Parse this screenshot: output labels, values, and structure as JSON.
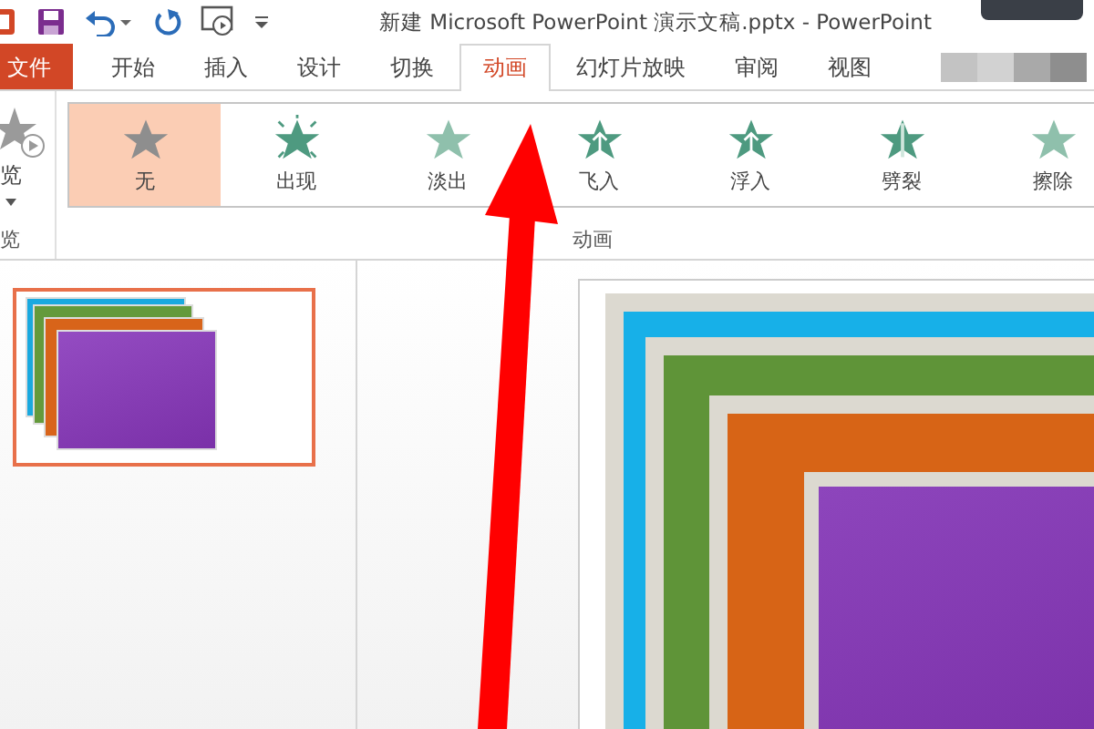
{
  "window": {
    "title": "新建 Microsoft PowerPoint 演示文稿.pptx - PowerPoint"
  },
  "tabs": [
    {
      "label": "文件",
      "kind": "file",
      "selected": false
    },
    {
      "label": "开始",
      "kind": "tab",
      "selected": false
    },
    {
      "label": "插入",
      "kind": "tab",
      "selected": false
    },
    {
      "label": "设计",
      "kind": "tab",
      "selected": false
    },
    {
      "label": "切换",
      "kind": "tab",
      "selected": false
    },
    {
      "label": "动画",
      "kind": "tab",
      "selected": true
    },
    {
      "label": "幻灯片放映",
      "kind": "tab",
      "selected": false
    },
    {
      "label": "审阅",
      "kind": "tab",
      "selected": false
    },
    {
      "label": "视图",
      "kind": "tab",
      "selected": false
    }
  ],
  "ribbon": {
    "preview": {
      "label": "览",
      "group_label": "览"
    },
    "animations": [
      {
        "label": "无",
        "kind": "none",
        "selected": true
      },
      {
        "label": "出现",
        "kind": "appear",
        "selected": false
      },
      {
        "label": "淡出",
        "kind": "fade",
        "selected": false
      },
      {
        "label": "飞入",
        "kind": "fly",
        "selected": false
      },
      {
        "label": "浮入",
        "kind": "float",
        "selected": false
      },
      {
        "label": "劈裂",
        "kind": "split",
        "selected": false
      },
      {
        "label": "擦除",
        "kind": "wipe",
        "selected": false
      }
    ],
    "group_label": "动画"
  },
  "slides": [
    {
      "selected": true
    }
  ]
}
